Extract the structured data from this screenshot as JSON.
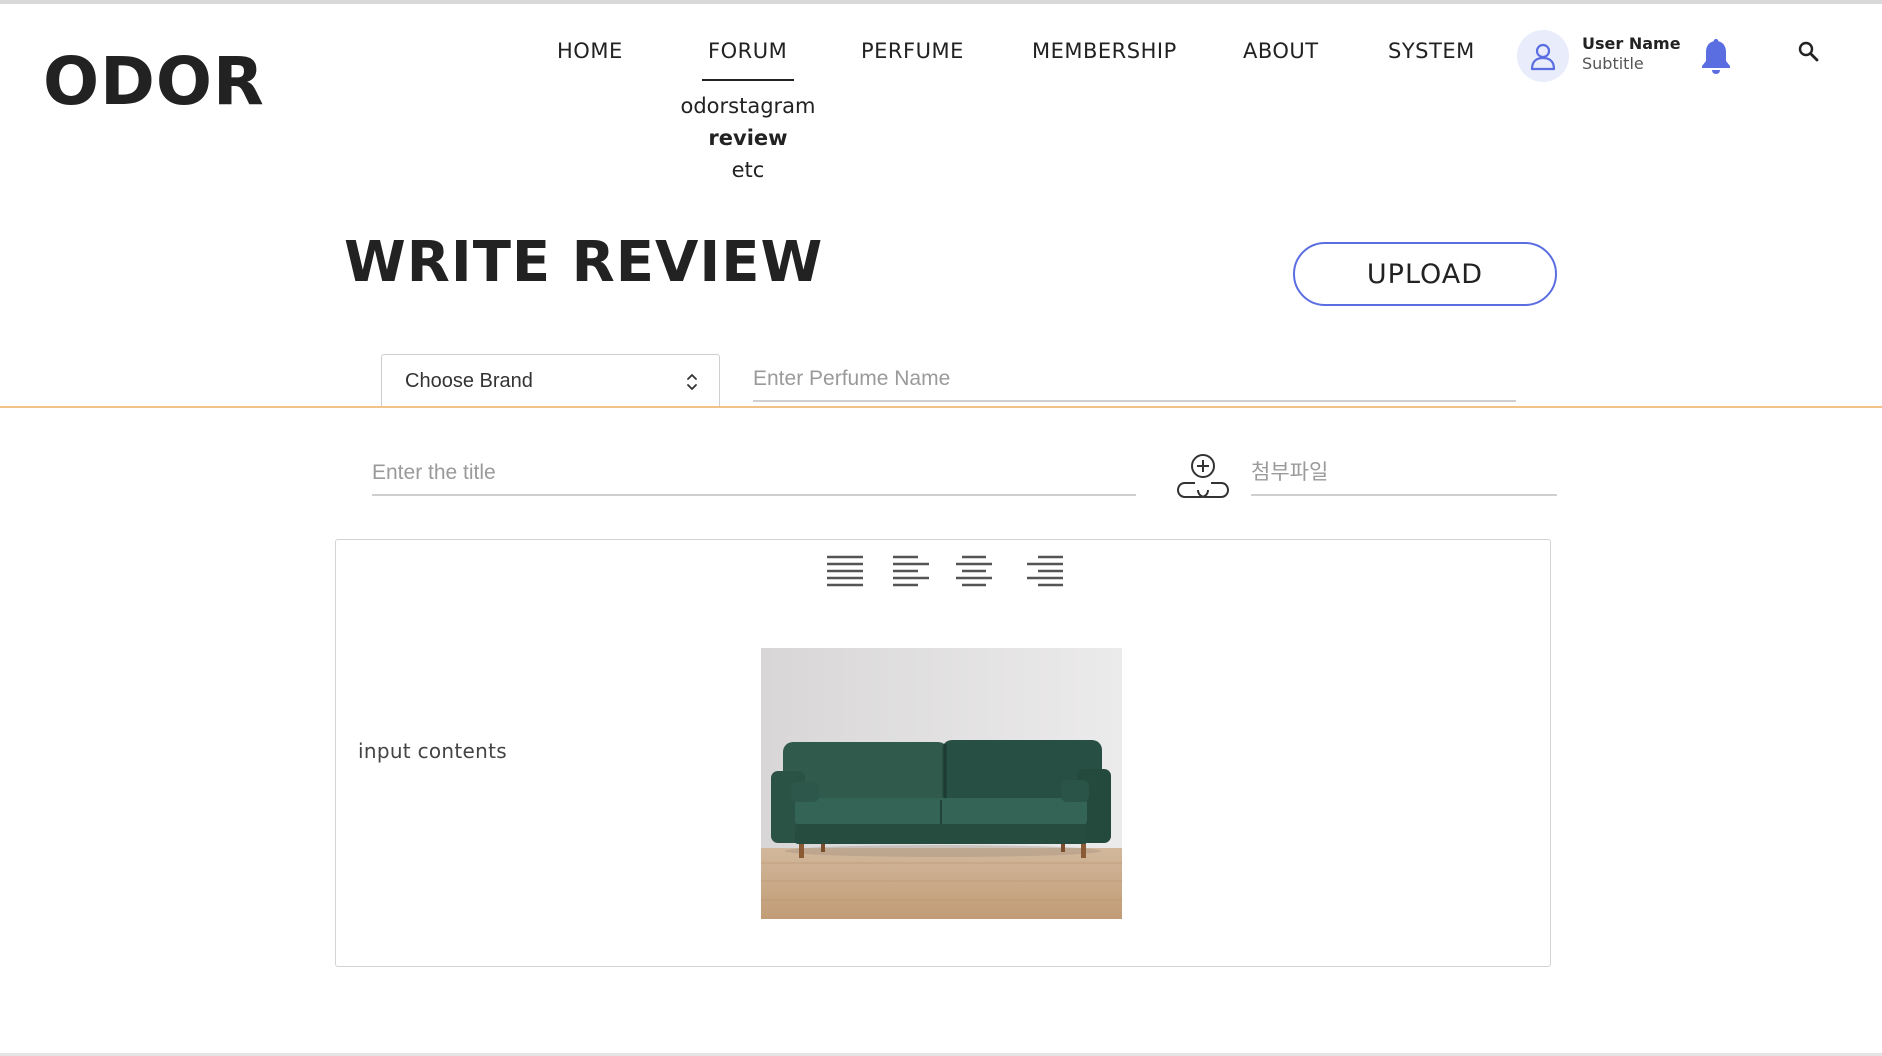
{
  "brand": {
    "logo": "ODOR"
  },
  "nav": {
    "items": [
      "HOME",
      "FORUM",
      "PERFUME",
      "MEMBERSHIP",
      "ABOUT",
      "SYSTEM"
    ],
    "active": "FORUM",
    "submenu": [
      "odorstagram",
      "review",
      "etc"
    ],
    "submenu_active": "review"
  },
  "user": {
    "name": "User Name",
    "subtitle": "Subtitle"
  },
  "icons": {
    "avatar": "user-icon",
    "notification": "bell-icon",
    "search": "search-icon",
    "attach": "attach-file-icon",
    "select": "chevron-updown-icon"
  },
  "page": {
    "title": "WRITE REVIEW",
    "upload_label": "UPLOAD"
  },
  "form": {
    "brand_select": "Choose Brand",
    "perfume_placeholder": "Enter Perfume Name",
    "title_placeholder": "Enter the title",
    "attach_placeholder": "첨부파일"
  },
  "editor": {
    "toolbar": [
      "align-justify-icon",
      "align-left-icon",
      "align-center-icon",
      "align-right-icon"
    ],
    "content_text": "input contents",
    "image": "green-sofa-photo"
  },
  "colors": {
    "accent": "#5b6ee1",
    "bell": "#5b6ee1",
    "avatar_bg": "#e8ecfb",
    "divider": "#f1c28a",
    "text": "#222222"
  }
}
